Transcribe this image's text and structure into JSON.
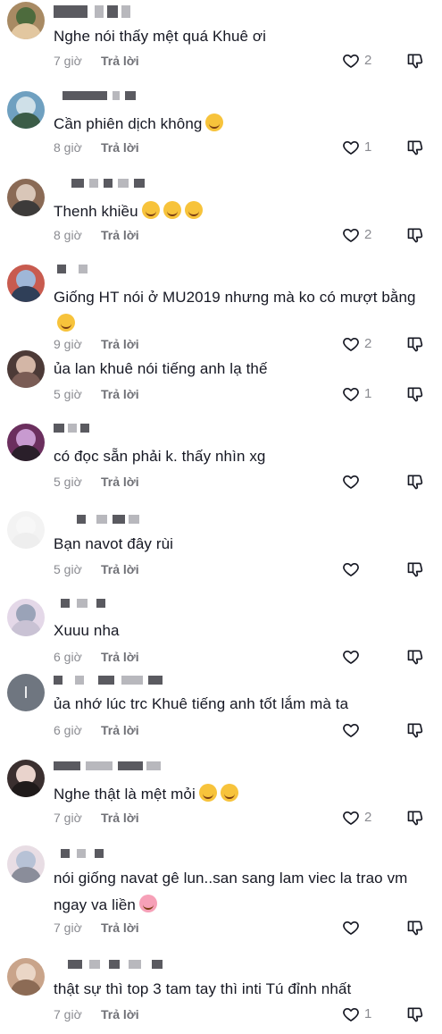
{
  "comments": [
    {
      "text": "Nghe nói thấy mệt quá Khuê ơi",
      "time": "7 giờ",
      "reply": "Trả lời",
      "likes": "2"
    },
    {
      "text": "Cần phiên dịch không",
      "emoji": [
        "laugh-tears"
      ],
      "time": "8 giờ",
      "reply": "Trả lời",
      "likes": "1"
    },
    {
      "text": "Thenh khiều",
      "emoji": [
        "laugh-tears",
        "laugh-tears",
        "laugh-tears"
      ],
      "time": "8 giờ",
      "reply": "Trả lời",
      "likes": "2"
    },
    {
      "text": "Giống HT nói ở MU2019 nhưng mà ko có mượt bằng",
      "emoji": [
        "rofl"
      ],
      "time": "9 giờ",
      "reply": "Trả lời",
      "likes": "2"
    },
    {
      "text": "ủa lan khuê nói tiếng anh lạ thế",
      "time": "5 giờ",
      "reply": "Trả lời",
      "likes": "1"
    },
    {
      "text": "có đọc sẵn phải k. thấy nhìn xg",
      "time": "5 giờ",
      "reply": "Trả lời",
      "likes": ""
    },
    {
      "text": "Bạn navot đây rùi",
      "time": "5 giờ",
      "reply": "Trả lời",
      "likes": ""
    },
    {
      "text": "Xuuu nha",
      "time": "6 giờ",
      "reply": "Trả lời",
      "likes": ""
    },
    {
      "text": "ủa nhớ lúc trc Khuê tiếng anh tốt lắm mà ta",
      "time": "6 giờ",
      "reply": "Trả lời",
      "likes": "",
      "avatar_letter": "I"
    },
    {
      "text": "Nghe thật là mệt mỏi",
      "emoji": [
        "sweat-smile",
        "sweat-smile"
      ],
      "time": "7 giờ",
      "reply": "Trả lời",
      "likes": "2"
    },
    {
      "text": "nói giống navat gê lun..san sang lam viec la trao vm ngay va liền",
      "emoji": [
        "smiling-hearts"
      ],
      "time": "7 giờ",
      "reply": "Trả lời",
      "likes": ""
    },
    {
      "text": "thật sự thì top 3 tam tay thì inti Tú đỉnh nhất",
      "time": "7 giờ",
      "reply": "Trả lời",
      "likes": "1"
    }
  ],
  "icons": {
    "like": "heart-outline-icon",
    "dislike": "thumbs-down-outline-icon"
  },
  "colors": {
    "text": "#161823",
    "meta": "#8a8b91",
    "icon": "#161823"
  }
}
